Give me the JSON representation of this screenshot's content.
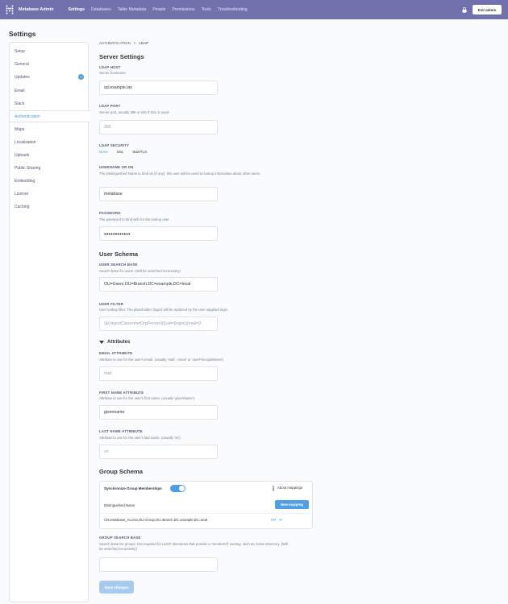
{
  "topnav": {
    "brand": "Metabase Admin",
    "links": [
      "Settings",
      "Databases",
      "Table Metadata",
      "People",
      "Permissions",
      "Tools",
      "Troubleshooting"
    ],
    "exit_label": "Exit admin"
  },
  "page_title": "Settings",
  "sidebar": {
    "items": [
      "Setup",
      "General",
      "Updates",
      "Email",
      "Slack",
      "Authentication",
      "Maps",
      "Localization",
      "Uploads",
      "Public Sharing",
      "Embedding",
      "License",
      "Caching"
    ],
    "updates_badge": "1",
    "active": "Authentication"
  },
  "breadcrumb": {
    "parent": "AUTHENTICATION",
    "separator": ">",
    "current": "LDAP"
  },
  "server_settings": {
    "title": "Server Settings",
    "host": {
      "label": "LDAP HOST",
      "desc": "Server hostname.",
      "value": "ad.example.lan"
    },
    "port": {
      "label": "LDAP PORT",
      "desc": "Server port, usually 389 or 636 if SSL is used.",
      "placeholder": "389"
    },
    "security": {
      "label": "LDAP SECURITY",
      "options": [
        "None",
        "SSL",
        "StartTLS"
      ],
      "selected": "None"
    },
    "username": {
      "label": "USERNAME OR DN",
      "desc": "The Distinguished Name to bind as (if any), this user will be used to lookup information about other users.",
      "value": "metabase"
    },
    "password": {
      "label": "PASSWORD",
      "desc": "The password to bind with for the lookup user.",
      "value": "●●●●●●●●●●●●"
    }
  },
  "user_schema": {
    "title": "User Schema",
    "search_base": {
      "label": "USER SEARCH BASE",
      "desc": "Search base for users. (Will be searched recursively)",
      "value": "OU=Users,OU=Branch,DC=example,DC=local"
    },
    "filter": {
      "label": "USER FILTER",
      "desc": "User lookup filter. The placeholder {login} will be replaced by the user supplied login.",
      "value": "(&(objectClass=inetOrgPerson)(|(uid={login})(mail={l"
    }
  },
  "attributes": {
    "toggle_label": "Attributes",
    "email": {
      "label": "EMAIL ATTRIBUTE",
      "desc": "Attribute to use for the user's email. (usually 'mail', 'email' or 'userPrincipalName')",
      "placeholder": "mail"
    },
    "first_name": {
      "label": "FIRST NAME ATTRIBUTE",
      "desc": "Attribute to use for the user's first name. (usually 'givenName')",
      "value": "givenname"
    },
    "last_name": {
      "label": "LAST NAME ATTRIBUTE",
      "desc": "Attribute to use for the user's last name. (usually 'sn')",
      "placeholder": "sn"
    }
  },
  "group_schema": {
    "title": "Group Schema",
    "sync_label": "Synchronize Group Memberships",
    "about_label": "About mappings",
    "new_mapping_label": "New mapping",
    "dn_header": "Distinguished Name",
    "mapping_dn": "CN=Metabase_Access,OU=Group,OU=Branch,DC=example,DC=local",
    "mapping_group": "HR",
    "search_base": {
      "label": "GROUP SEARCH BASE",
      "desc": "Search base for groups. Not required for LDAP directories that provide a 'memberOf' overlay, such as Active Directory. (Will be searched recursively)",
      "value": ""
    }
  },
  "save_label": "Save changes",
  "colors": {
    "nav": "#7172ad",
    "accent": "#509ee3"
  }
}
